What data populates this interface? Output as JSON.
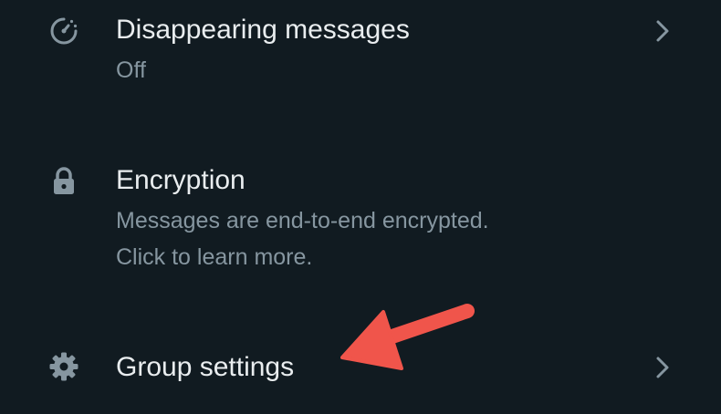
{
  "rows": [
    {
      "title": "Disappearing messages",
      "subtitle": "Off",
      "icon": "disappearing-timer-icon"
    },
    {
      "title": "Encryption",
      "subtitle_line1": "Messages are end-to-end encrypted.",
      "subtitle_line2": "Click to learn more.",
      "icon": "lock-icon"
    },
    {
      "title": "Group settings",
      "icon": "gear-icon"
    }
  ],
  "colors": {
    "background": "#111b21",
    "title": "#e9edef",
    "subtitle": "#8696a0",
    "icon": "#8696a0",
    "annotation_arrow": "#f0554b"
  }
}
